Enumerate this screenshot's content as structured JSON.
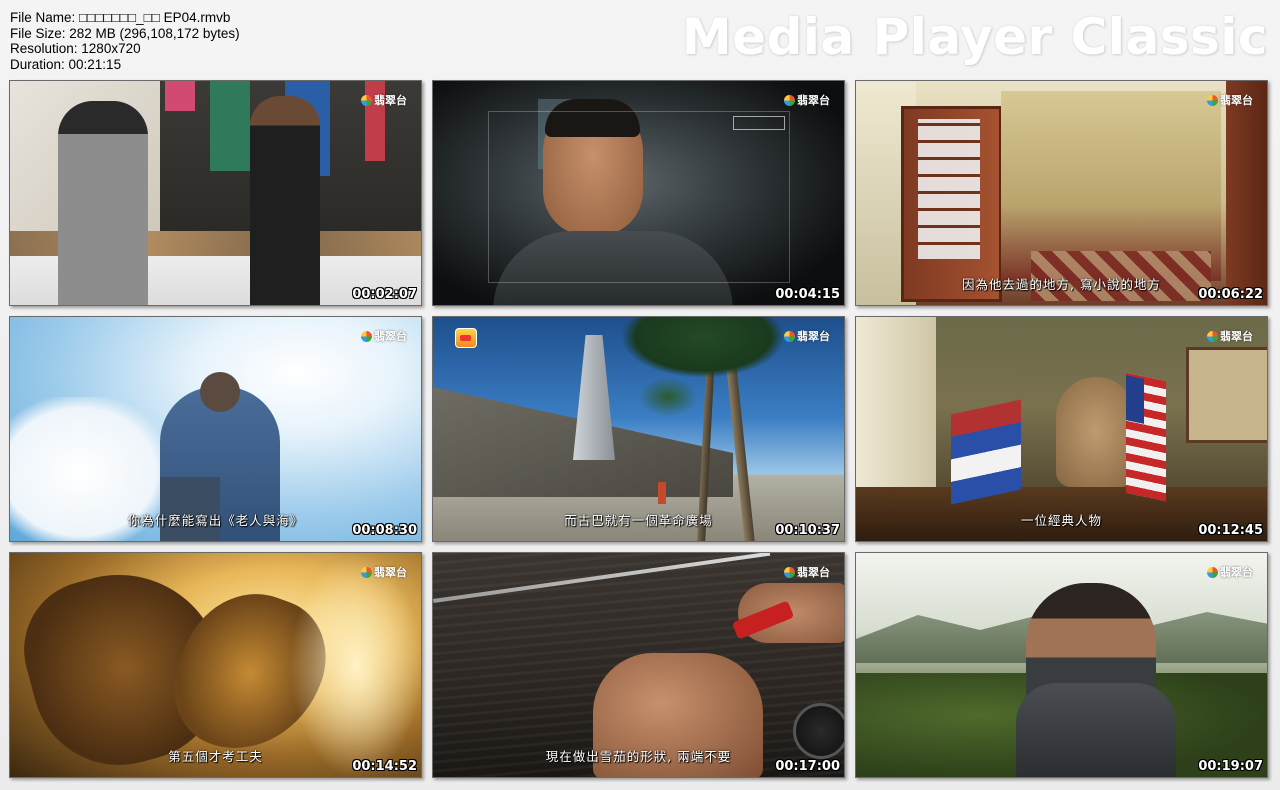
{
  "header": {
    "file_name": "File Name: □□□□□□□_□□ EP04.rmvb",
    "file_size": "File Size: 282 MB (296,108,172 bytes)",
    "resolution": "Resolution: 1280x720",
    "duration": "Duration: 00:21:15",
    "brand": "Media Player Classic"
  },
  "thumbnails": [
    {
      "time": "00:02:07",
      "subtitle": "",
      "channel_logo": "翡翠台"
    },
    {
      "time": "00:04:15",
      "subtitle": "",
      "channel_logo": "翡翠台"
    },
    {
      "time": "00:06:22",
      "subtitle": "因為他去過的地方, 寫小說的地方",
      "channel_logo": "翡翠台"
    },
    {
      "time": "00:08:30",
      "subtitle": "你為什麼能寫出《老人與海》",
      "channel_logo": "翡翠台"
    },
    {
      "time": "00:10:37",
      "subtitle": "而古巴就有一個革命廣場",
      "channel_logo": "翡翠台"
    },
    {
      "time": "00:12:45",
      "subtitle": "一位經典人物",
      "channel_logo": "翡翠台"
    },
    {
      "time": "00:14:52",
      "subtitle": "第五個才考工夫",
      "channel_logo": "翡翠台"
    },
    {
      "time": "00:17:00",
      "subtitle": "現在做出雪茄的形狀, 兩端不要",
      "channel_logo": "翡翠台"
    },
    {
      "time": "00:19:07",
      "subtitle": "",
      "channel_logo": "翡翠台"
    }
  ]
}
